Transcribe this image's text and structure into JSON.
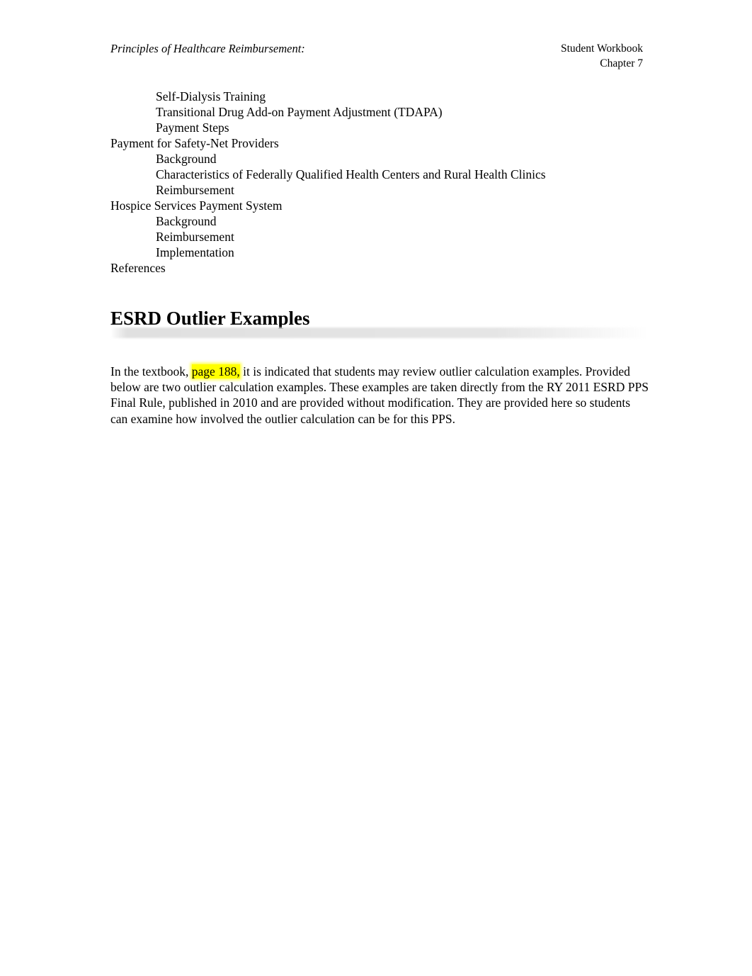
{
  "header": {
    "left_title": "Principles of Healthcare Reimbursement:",
    "right_line1": "Student Workbook",
    "right_line2": "Chapter 7"
  },
  "toc": {
    "items": [
      {
        "label": "Self-Dialysis Training",
        "level": 1
      },
      {
        "label": "Transitional Drug Add-on Payment Adjustment (TDAPA)",
        "level": 1
      },
      {
        "label": "Payment Steps",
        "level": 1
      },
      {
        "label": "Payment for Safety-Net Providers",
        "level": 0
      },
      {
        "label": "Background",
        "level": 1
      },
      {
        "label": "Characteristics of Federally Qualified Health Centers and Rural Health Clinics",
        "level": 1
      },
      {
        "label": "Reimbursement",
        "level": 1
      },
      {
        "label": "Hospice Services Payment System",
        "level": 0
      },
      {
        "label": "Background",
        "level": 1
      },
      {
        "label": "Reimbursement",
        "level": 1
      },
      {
        "label": "Implementation",
        "level": 1
      },
      {
        "label": "References",
        "level": 0
      }
    ]
  },
  "section": {
    "heading": "ESRD Outlier Examples"
  },
  "paragraph": {
    "part1": "In the textbook, ",
    "highlight": "page 188,",
    "part2": " it is indicated that students may review outlier calculation examples.  Provided below are two outlier calculation examples.  These examples are taken directly from the RY 2011 ESRD PPS Final Rule, published in 2010 and are provided without modification.  They are provided here so students can examine how involved the outlier calculation can be for this PPS."
  },
  "colors": {
    "highlight": "#ffff00",
    "text": "#000000",
    "page_background": "#ffffff",
    "rule": "#e2e2e2"
  }
}
